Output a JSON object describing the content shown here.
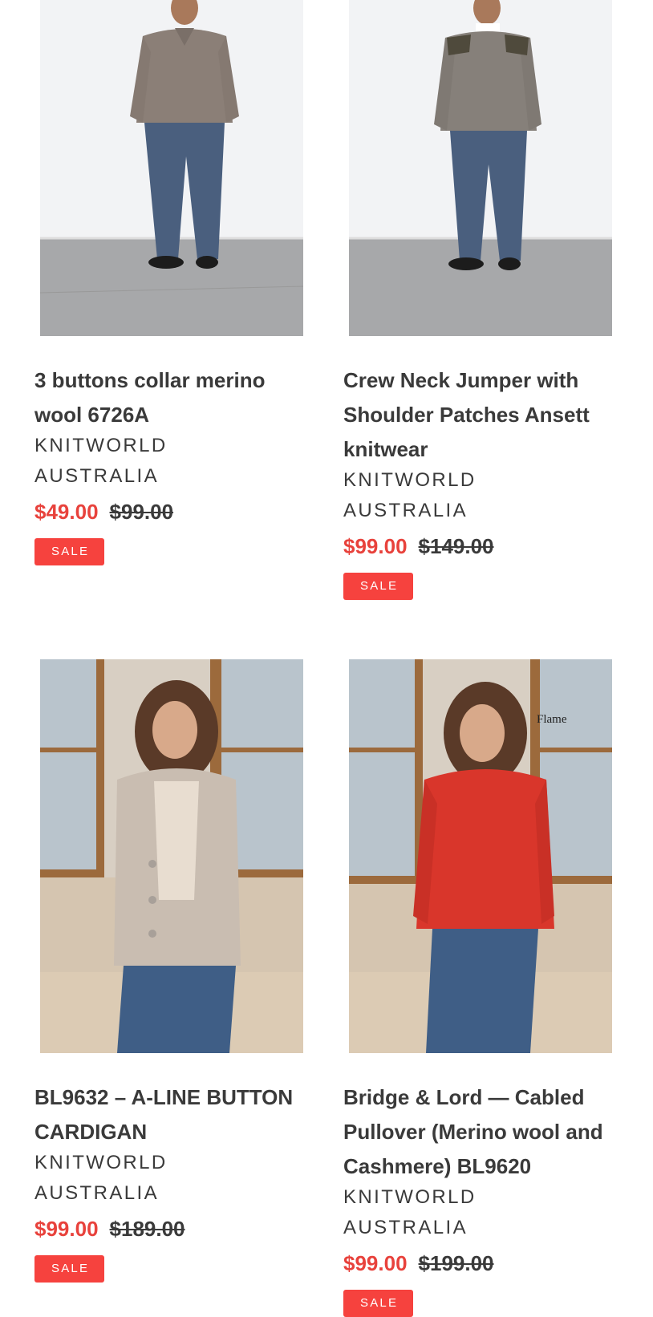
{
  "products": [
    {
      "title": "3 buttons collar merino wool 6726A",
      "vendor": "KNITWORLD AUSTRALIA",
      "sale_price": "$49.00",
      "regular_price": "$99.00",
      "badge": "SALE",
      "image_type": "man-sweater-polo"
    },
    {
      "title": "Crew Neck Jumper with Shoulder Patches Ansett knitwear",
      "vendor": "KNITWORLD AUSTRALIA",
      "sale_price": "$99.00",
      "regular_price": "$149.00",
      "badge": "SALE",
      "image_type": "man-sweater-crew"
    },
    {
      "title": "BL9632 – A-LINE BUTTON CARDIGAN",
      "vendor": "KNITWORLD AUSTRALIA",
      "sale_price": "$99.00",
      "regular_price": "$189.00",
      "badge": "SALE",
      "image_type": "woman-cardigan"
    },
    {
      "title": "Bridge & Lord — Cabled Pullover (Merino wool and Cashmere) BL9620",
      "vendor": "KNITWORLD AUSTRALIA",
      "sale_price": "$99.00",
      "regular_price": "$199.00",
      "badge": "SALE",
      "image_type": "woman-red-pullover",
      "image_caption": "Flame"
    }
  ],
  "colors": {
    "sale": "#e8423c",
    "badge_bg": "#f6423e",
    "text": "#3a3a3a",
    "red_sweater": "#d9362b",
    "grey_sweater": "#8b7f77",
    "cardigan": "#c9bdb1"
  }
}
